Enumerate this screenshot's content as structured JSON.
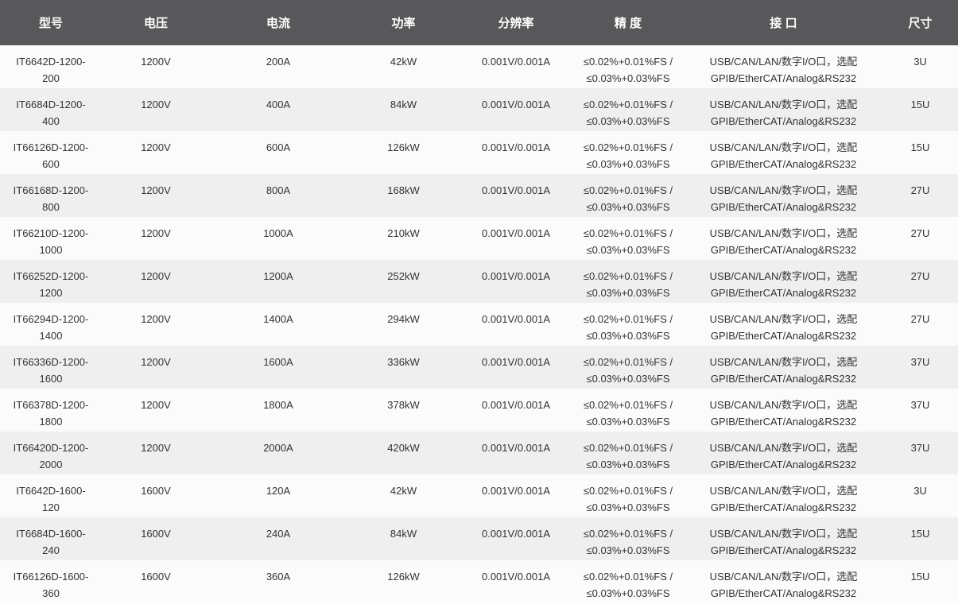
{
  "colors": {
    "header_bg": "#58585a",
    "header_text": "#ffffff",
    "row_odd_bg": "#fbfbfb",
    "row_even_bg": "#efefef",
    "cell_text": "#333333"
  },
  "table": {
    "columns": [
      {
        "key": "model",
        "label": "型号"
      },
      {
        "key": "voltage",
        "label": "电压"
      },
      {
        "key": "current",
        "label": "电流"
      },
      {
        "key": "power",
        "label": "功率"
      },
      {
        "key": "resolution",
        "label": "分辨率"
      },
      {
        "key": "accuracy",
        "label": "精 度"
      },
      {
        "key": "interface",
        "label": "接 口"
      },
      {
        "key": "size",
        "label": "尺寸"
      }
    ],
    "rows": [
      {
        "model_line1": "IT6642D-1200-",
        "model_line2": "200",
        "voltage": "1200V",
        "current": "200A",
        "power": "42kW",
        "resolution": "0.001V/0.001A",
        "accuracy_line1": "≤0.02%+0.01%FS /",
        "accuracy_line2": "≤0.03%+0.03%FS",
        "interface_line1": "USB/CAN/LAN/数字I/O口，选配",
        "interface_line2": "GPIB/EtherCAT/Analog&RS232",
        "size": "3U"
      },
      {
        "model_line1": "IT6684D-1200-",
        "model_line2": "400",
        "voltage": "1200V",
        "current": "400A",
        "power": "84kW",
        "resolution": "0.001V/0.001A",
        "accuracy_line1": "≤0.02%+0.01%FS /",
        "accuracy_line2": "≤0.03%+0.03%FS",
        "interface_line1": "USB/CAN/LAN/数字I/O口，选配",
        "interface_line2": "GPIB/EtherCAT/Analog&RS232",
        "size": "15U"
      },
      {
        "model_line1": "IT66126D-1200-",
        "model_line2": "600",
        "voltage": "1200V",
        "current": "600A",
        "power": "126kW",
        "resolution": "0.001V/0.001A",
        "accuracy_line1": "≤0.02%+0.01%FS /",
        "accuracy_line2": "≤0.03%+0.03%FS",
        "interface_line1": "USB/CAN/LAN/数字I/O口，选配",
        "interface_line2": "GPIB/EtherCAT/Analog&RS232",
        "size": "15U"
      },
      {
        "model_line1": "IT66168D-1200-",
        "model_line2": "800",
        "voltage": "1200V",
        "current": "800A",
        "power": "168kW",
        "resolution": "0.001V/0.001A",
        "accuracy_line1": "≤0.02%+0.01%FS /",
        "accuracy_line2": "≤0.03%+0.03%FS",
        "interface_line1": "USB/CAN/LAN/数字I/O口，选配",
        "interface_line2": "GPIB/EtherCAT/Analog&RS232",
        "size": "27U"
      },
      {
        "model_line1": "IT66210D-1200-",
        "model_line2": "1000",
        "voltage": "1200V",
        "current": "1000A",
        "power": "210kW",
        "resolution": "0.001V/0.001A",
        "accuracy_line1": "≤0.02%+0.01%FS /",
        "accuracy_line2": "≤0.03%+0.03%FS",
        "interface_line1": "USB/CAN/LAN/数字I/O口，选配",
        "interface_line2": "GPIB/EtherCAT/Analog&RS232",
        "size": "27U"
      },
      {
        "model_line1": "IT66252D-1200-",
        "model_line2": "1200",
        "voltage": "1200V",
        "current": "1200A",
        "power": "252kW",
        "resolution": "0.001V/0.001A",
        "accuracy_line1": "≤0.02%+0.01%FS /",
        "accuracy_line2": "≤0.03%+0.03%FS",
        "interface_line1": "USB/CAN/LAN/数字I/O口，选配",
        "interface_line2": "GPIB/EtherCAT/Analog&RS232",
        "size": "27U"
      },
      {
        "model_line1": "IT66294D-1200-",
        "model_line2": "1400",
        "voltage": "1200V",
        "current": "1400A",
        "power": "294kW",
        "resolution": "0.001V/0.001A",
        "accuracy_line1": "≤0.02%+0.01%FS /",
        "accuracy_line2": "≤0.03%+0.03%FS",
        "interface_line1": "USB/CAN/LAN/数字I/O口，选配",
        "interface_line2": "GPIB/EtherCAT/Analog&RS232",
        "size": "27U"
      },
      {
        "model_line1": "IT66336D-1200-",
        "model_line2": "1600",
        "voltage": "1200V",
        "current": "1600A",
        "power": "336kW",
        "resolution": "0.001V/0.001A",
        "accuracy_line1": "≤0.02%+0.01%FS /",
        "accuracy_line2": "≤0.03%+0.03%FS",
        "interface_line1": "USB/CAN/LAN/数字I/O口，选配",
        "interface_line2": "GPIB/EtherCAT/Analog&RS232",
        "size": "37U"
      },
      {
        "model_line1": "IT66378D-1200-",
        "model_line2": "1800",
        "voltage": "1200V",
        "current": "1800A",
        "power": "378kW",
        "resolution": "0.001V/0.001A",
        "accuracy_line1": "≤0.02%+0.01%FS /",
        "accuracy_line2": "≤0.03%+0.03%FS",
        "interface_line1": "USB/CAN/LAN/数字I/O口，选配",
        "interface_line2": "GPIB/EtherCAT/Analog&RS232",
        "size": "37U"
      },
      {
        "model_line1": "IT66420D-1200-",
        "model_line2": "2000",
        "voltage": "1200V",
        "current": "2000A",
        "power": "420kW",
        "resolution": "0.001V/0.001A",
        "accuracy_line1": "≤0.02%+0.01%FS /",
        "accuracy_line2": "≤0.03%+0.03%FS",
        "interface_line1": "USB/CAN/LAN/数字I/O口，选配",
        "interface_line2": "GPIB/EtherCAT/Analog&RS232",
        "size": "37U"
      },
      {
        "model_line1": "IT6642D-1600-",
        "model_line2": "120",
        "voltage": "1600V",
        "current": "120A",
        "power": "42kW",
        "resolution": "0.001V/0.001A",
        "accuracy_line1": "≤0.02%+0.01%FS /",
        "accuracy_line2": "≤0.03%+0.03%FS",
        "interface_line1": "USB/CAN/LAN/数字I/O口，选配",
        "interface_line2": "GPIB/EtherCAT/Analog&RS232",
        "size": "3U"
      },
      {
        "model_line1": "IT6684D-1600-",
        "model_line2": "240",
        "voltage": "1600V",
        "current": "240A",
        "power": "84kW",
        "resolution": "0.001V/0.001A",
        "accuracy_line1": "≤0.02%+0.01%FS /",
        "accuracy_line2": "≤0.03%+0.03%FS",
        "interface_line1": "USB/CAN/LAN/数字I/O口，选配",
        "interface_line2": "GPIB/EtherCAT/Analog&RS232",
        "size": "15U"
      },
      {
        "model_line1": "IT66126D-1600-",
        "model_line2": "360",
        "voltage": "1600V",
        "current": "360A",
        "power": "126kW",
        "resolution": "0.001V/0.001A",
        "accuracy_line1": "≤0.02%+0.01%FS /",
        "accuracy_line2": "≤0.03%+0.03%FS",
        "interface_line1": "USB/CAN/LAN/数字I/O口，选配",
        "interface_line2": "GPIB/EtherCAT/Analog&RS232",
        "size": "15U"
      }
    ]
  }
}
